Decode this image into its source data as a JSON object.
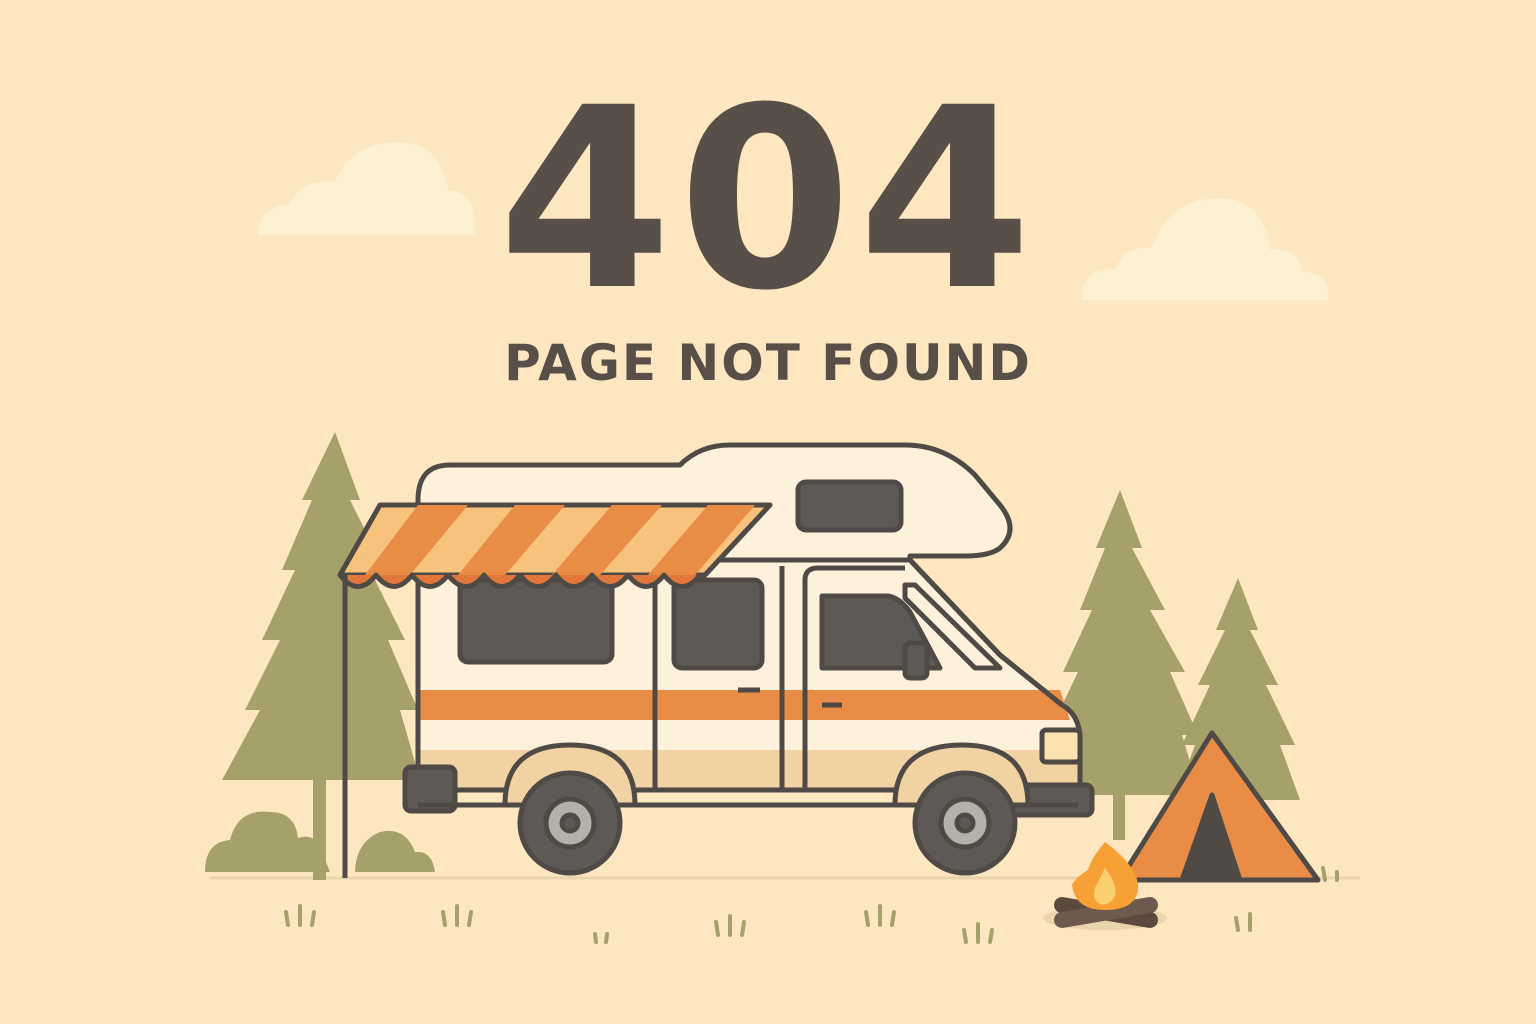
{
  "error": {
    "code": "404",
    "message": "PAGE NOT FOUND"
  },
  "illustration": {
    "icons": [
      "cloud-icon",
      "pine-tree-icon",
      "camper-van-icon",
      "awning-icon",
      "tent-icon",
      "campfire-icon",
      "bush-icon",
      "grass-tuft-icon"
    ]
  },
  "colors": {
    "background": "#fde7c1",
    "text": "#574f48",
    "tree": "#a6a06a",
    "accent_orange": "#e98d46",
    "van_body": "#fdf1dc",
    "outline": "#4f4a45"
  }
}
